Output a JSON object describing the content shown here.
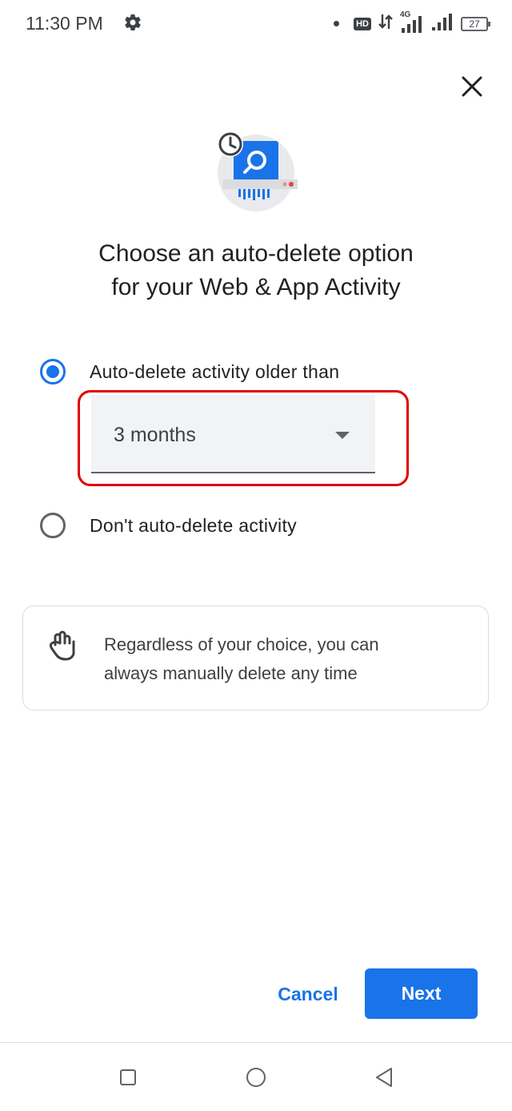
{
  "status_bar": {
    "time": "11:30 PM",
    "network_badge": "HD",
    "network_type": "4G",
    "battery": "27"
  },
  "dialog": {
    "title_line1": "Choose an auto-delete option",
    "title_line2": "for your Web & App Activity",
    "options": [
      {
        "label": "Auto-delete activity older than",
        "selected": true
      },
      {
        "label": "Don't auto-delete activity",
        "selected": false
      }
    ],
    "dropdown": {
      "value": "3 months"
    },
    "info": {
      "line1": "Regardless of your choice, you can",
      "line2": "always manually delete any time"
    },
    "cancel_label": "Cancel",
    "next_label": "Next"
  },
  "colors": {
    "accent": "#1a73e8",
    "highlight": "#e00000",
    "dropdown_bg": "#f1f3f4"
  },
  "icons": [
    "settings-icon",
    "close-icon",
    "auto-delete-illustration",
    "hand-icon",
    "recents-icon",
    "home-icon",
    "back-icon"
  ]
}
